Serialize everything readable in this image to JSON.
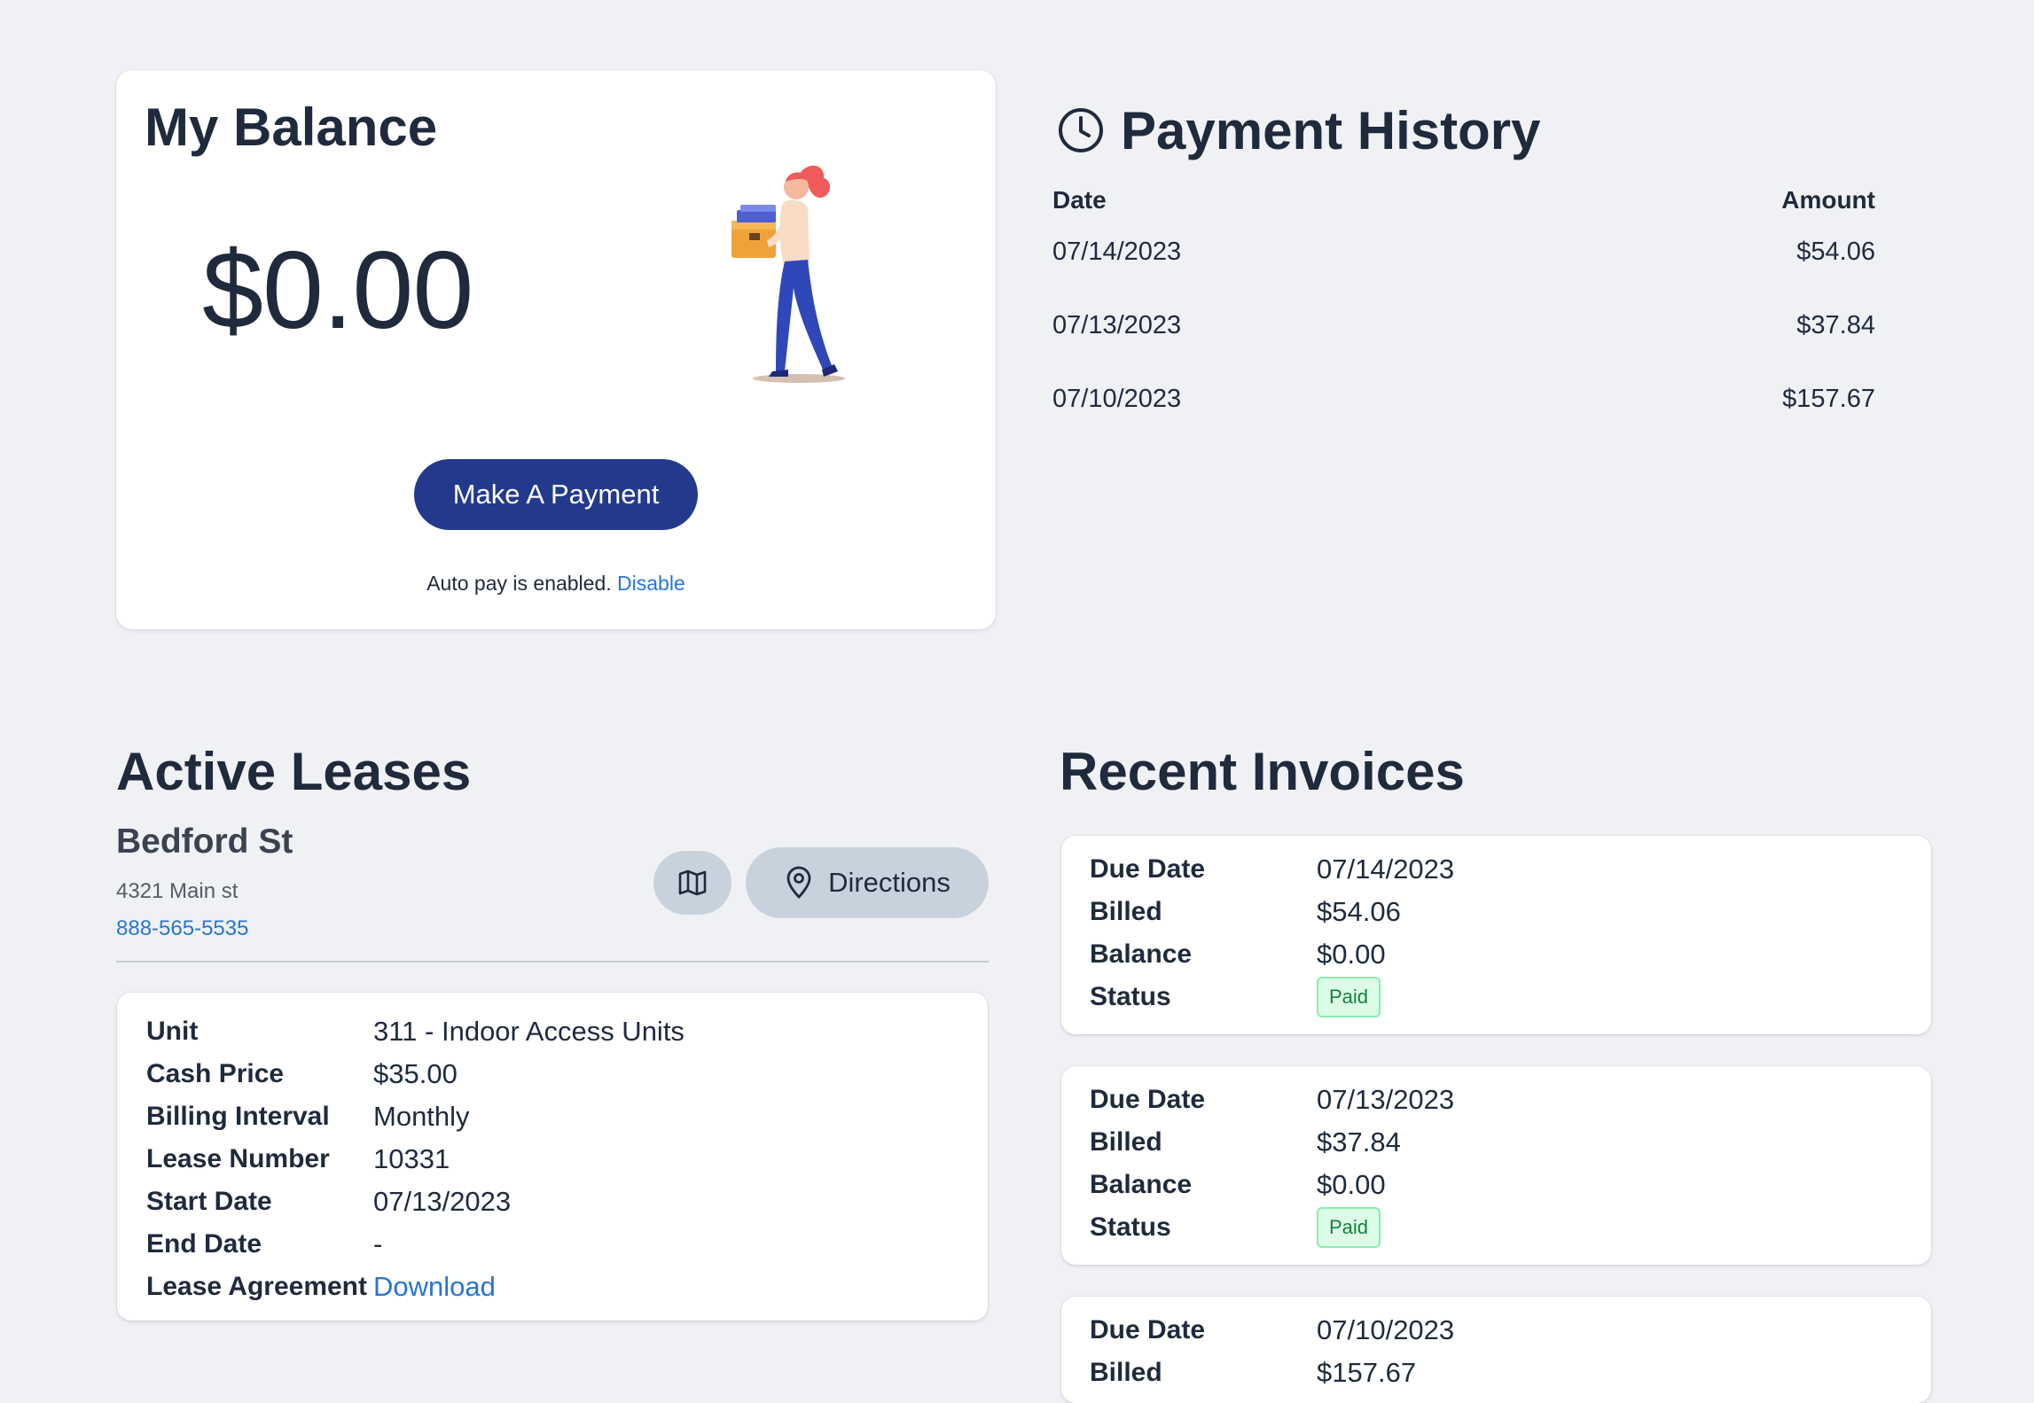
{
  "balance": {
    "title": "My Balance",
    "amount": "$0.00",
    "pay_button": "Make A Payment",
    "autopay_text": "Auto pay is enabled.",
    "autopay_link": "Disable"
  },
  "payment_history": {
    "title": "Payment History",
    "columns": [
      "Date",
      "Amount"
    ],
    "rows": [
      {
        "date": "07/14/2023",
        "amount": "$54.06"
      },
      {
        "date": "07/13/2023",
        "amount": "$37.84"
      },
      {
        "date": "07/10/2023",
        "amount": "$157.67"
      }
    ]
  },
  "leases": {
    "title": "Active Leases",
    "property": {
      "name": "Bedford St",
      "address": "4321 Main st",
      "phone": "888-565-5535"
    },
    "directions_label": "Directions",
    "details": [
      {
        "label": "Unit",
        "value": "311 - Indoor Access Units"
      },
      {
        "label": "Cash Price",
        "value": "$35.00"
      },
      {
        "label": "Billing Interval",
        "value": "Monthly"
      },
      {
        "label": "Lease Number",
        "value": "10331"
      },
      {
        "label": "Start Date",
        "value": "07/13/2023"
      },
      {
        "label": "End Date",
        "value": "-"
      },
      {
        "label": "Lease Agreement",
        "value": "Download"
      }
    ]
  },
  "invoices": {
    "title": "Recent Invoices",
    "labels": {
      "due_date": "Due Date",
      "billed": "Billed",
      "balance": "Balance",
      "status": "Status"
    },
    "items": [
      {
        "due_date": "07/14/2023",
        "billed": "$54.06",
        "balance": "$0.00",
        "status": "Paid"
      },
      {
        "due_date": "07/13/2023",
        "billed": "$37.84",
        "balance": "$0.00",
        "status": "Paid"
      },
      {
        "due_date": "07/10/2023",
        "billed": "$157.67"
      }
    ]
  },
  "colors": {
    "page_bg": "#f0f1f4",
    "primary_button": "#233a8c",
    "link": "#2874d8",
    "secondary_button": "#c8d2dd",
    "paid_badge_bg": "#dcfce7",
    "paid_badge_text": "#15803d"
  }
}
